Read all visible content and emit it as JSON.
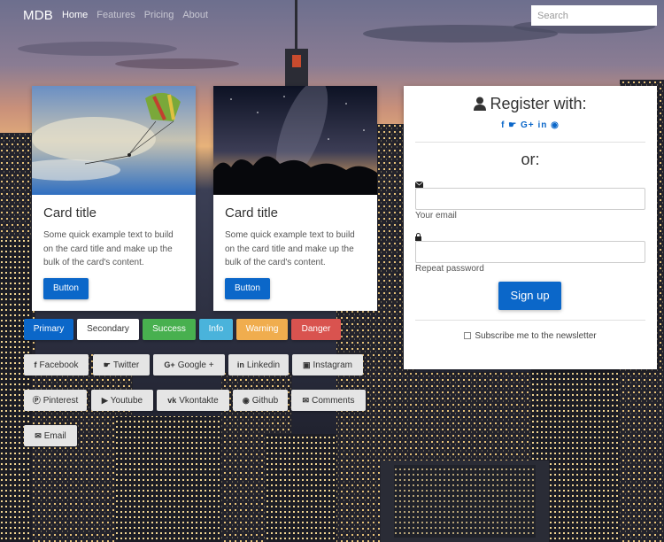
{
  "navbar": {
    "brand": "MDB",
    "links": [
      "Home",
      "Features",
      "Pricing",
      "About"
    ],
    "search_placeholder": "Search"
  },
  "cards": [
    {
      "title": "Card title",
      "text": "Some quick example text to build on the card title and make up the bulk of the card's content.",
      "button": "Button"
    },
    {
      "title": "Card title",
      "text": "Some quick example text to build on the card title and make up the bulk of the card's content.",
      "button": "Button"
    }
  ],
  "color_buttons": [
    {
      "label": "Primary",
      "color": "#0b67c9"
    },
    {
      "label": "Secondary",
      "color": "#ffffff"
    },
    {
      "label": "Success",
      "color": "#48b04f"
    },
    {
      "label": "Info",
      "color": "#4ab3db"
    },
    {
      "label": "Warning",
      "color": "#f0ad4e"
    },
    {
      "label": "Danger",
      "color": "#d9534f"
    }
  ],
  "social_buttons": [
    {
      "label": "Facebook",
      "icon": "facebook-icon"
    },
    {
      "label": "Twitter",
      "icon": "twitter-icon"
    },
    {
      "label": "Google +",
      "icon": "google-plus-icon"
    },
    {
      "label": "Linkedin",
      "icon": "linkedin-icon"
    },
    {
      "label": "Instagram",
      "icon": "instagram-icon"
    },
    {
      "label": "Pinterest",
      "icon": "pinterest-icon"
    },
    {
      "label": "Youtube",
      "icon": "youtube-icon"
    },
    {
      "label": "Vkontakte",
      "icon": "vkontakte-icon"
    },
    {
      "label": "Github",
      "icon": "github-icon"
    },
    {
      "label": "Comments",
      "icon": "comments-icon"
    },
    {
      "label": "Email",
      "icon": "email-icon"
    }
  ],
  "register": {
    "title": "Register with:",
    "social_icons": [
      "facebook-icon",
      "twitter-icon",
      "google-plus-icon",
      "linkedin-icon",
      "github-icon"
    ],
    "or_text": "or:",
    "email_label": "Your email",
    "password_label": "Repeat password",
    "signup_label": "Sign up",
    "subscribe_label": "Subscribe me to the newsletter"
  }
}
